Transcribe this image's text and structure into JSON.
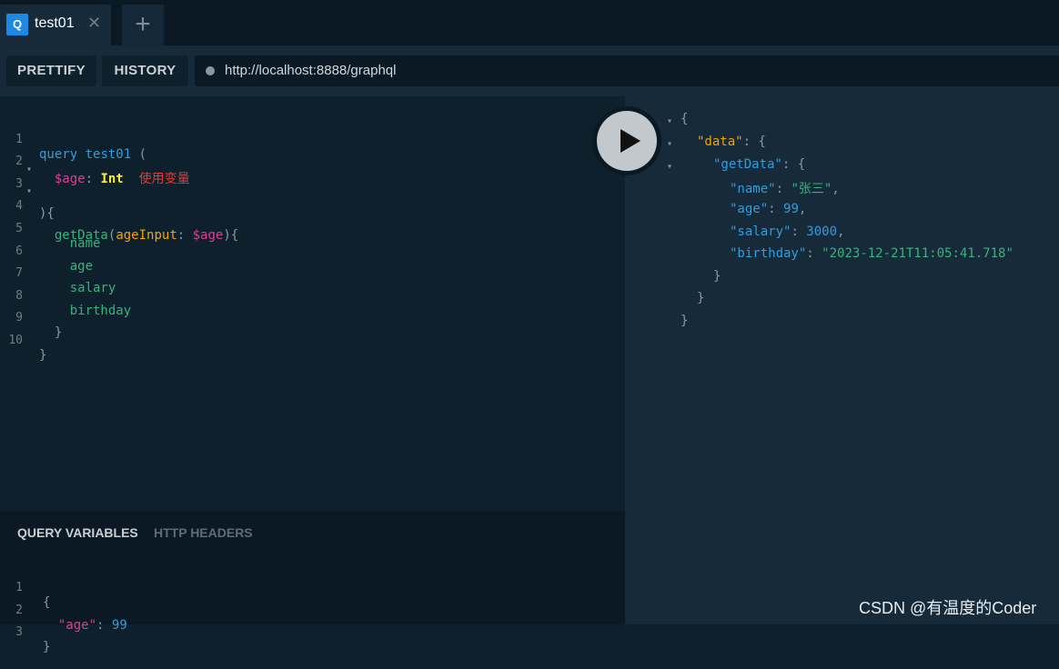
{
  "tabs": {
    "active": {
      "badge": "Q",
      "title": "test01",
      "close": "✕"
    },
    "add_label": "+"
  },
  "toolbar": {
    "prettify_label": "PRETTIFY",
    "history_label": "HISTORY",
    "url": "http://localhost:8888/graphql"
  },
  "editor": {
    "line_numbers": [
      "1",
      "2",
      "3",
      "4",
      "5",
      "6",
      "7",
      "8",
      "9",
      "10"
    ],
    "tokens": {
      "query_kw": "query",
      "op_name": "test01",
      "open_paren": "(",
      "var_name": "$age",
      "colon": ":",
      "type": "Int",
      "annotation": "使用变量",
      "close_paren_brace": "){",
      "field_getData": "getData",
      "arg_open": "(",
      "arg_name": "ageInput",
      "arg_colon": ":",
      "arg_var": "$age",
      "arg_close": "){",
      "field_name": "name",
      "field_age": "age",
      "field_salary": "salary",
      "field_birthday": "birthday",
      "close_inner": "}",
      "close_outer": "}"
    }
  },
  "variables_panel": {
    "tab_query_variables": "QUERY VARIABLES",
    "tab_http_headers": "HTTP HEADERS",
    "line_numbers": [
      "1",
      "2",
      "3"
    ],
    "open": "{",
    "key": "\"age\"",
    "colon": ":",
    "value": "99",
    "close": "}"
  },
  "result": {
    "open": "{",
    "data_key": "\"data\"",
    "getData_key": "\"getData\"",
    "colon_brace": ": {",
    "name_key": "\"name\"",
    "name_value": "\"张三\"",
    "age_key": "\"age\"",
    "age_value": "99",
    "salary_key": "\"salary\"",
    "salary_value": "3000",
    "birthday_key": "\"birthday\"",
    "birthday_value": "\"2023-12-21T11:05:41.718\"",
    "colon": ": ",
    "comma": ",",
    "close": "}"
  },
  "watermark": "CSDN @有温度的Coder",
  "colors": {
    "background": "#0f202d",
    "panel": "#172a3a",
    "keyword": "#2d9ee0",
    "variable": "#d64292",
    "field": "#36b37e",
    "type": "#ffeb3b",
    "annotation": "#e53935"
  }
}
